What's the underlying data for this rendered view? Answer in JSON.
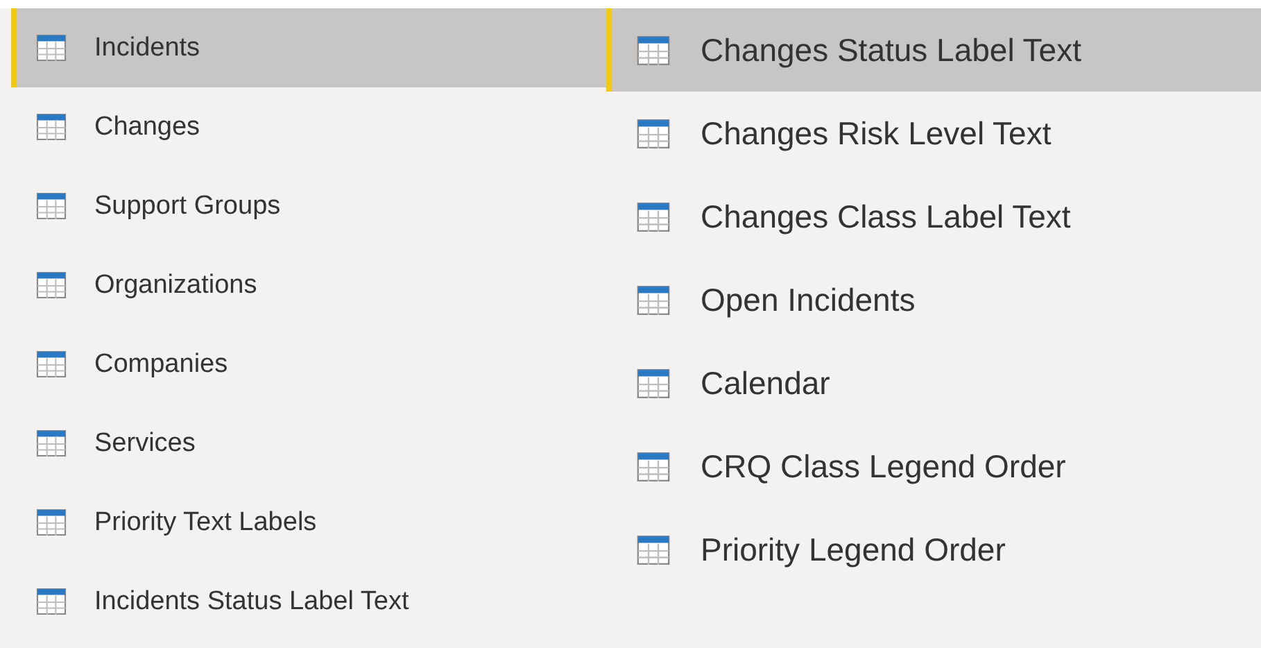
{
  "left_list": [
    {
      "label": "Incidents",
      "selected": true
    },
    {
      "label": "Changes",
      "selected": false
    },
    {
      "label": "Support Groups",
      "selected": false
    },
    {
      "label": "Organizations",
      "selected": false
    },
    {
      "label": "Companies",
      "selected": false
    },
    {
      "label": "Services",
      "selected": false
    },
    {
      "label": "Priority Text Labels",
      "selected": false
    },
    {
      "label": "Incidents Status Label Text",
      "selected": false
    }
  ],
  "right_list": [
    {
      "label": "Changes Status Label Text",
      "selected": true
    },
    {
      "label": "Changes Risk Level Text",
      "selected": false
    },
    {
      "label": "Changes Class Label Text",
      "selected": false
    },
    {
      "label": "Open Incidents",
      "selected": false
    },
    {
      "label": "Calendar",
      "selected": false
    },
    {
      "label": "CRQ Class Legend Order",
      "selected": false
    },
    {
      "label": "Priority Legend Order",
      "selected": false
    }
  ]
}
